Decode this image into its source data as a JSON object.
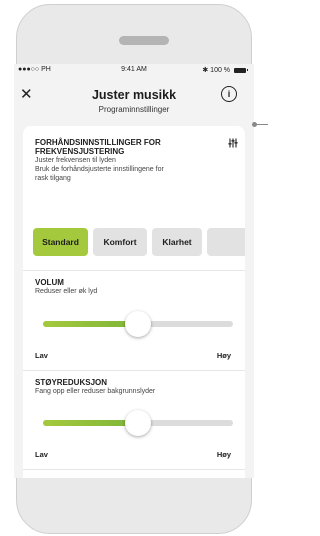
{
  "statusbar": {
    "carrier": "●●●○○ PH",
    "time": "9:41 AM",
    "battery": "✱ 100 %"
  },
  "header": {
    "title": "Juster musikk",
    "subtitle": "Programinnstillinger",
    "close_glyph": "✕",
    "info_glyph": "i"
  },
  "presets_section": {
    "title_line1": "FORHÅNDSINNSTILLINGER FOR",
    "title_line2": "FREKVENSJUSTERING",
    "desc_line1": "Juster frekvensen til lyden",
    "desc_line2": "Bruk de forhåndsjusterte innstillingene for",
    "desc_line3": "rask tilgang",
    "eq_icon": "equalizer-icon",
    "buttons": [
      {
        "label": "Standard",
        "active": true
      },
      {
        "label": "Komfort",
        "active": false
      },
      {
        "label": "Klarhet",
        "active": false
      },
      {
        "label": "",
        "active": false
      }
    ]
  },
  "volume": {
    "title": "VOLUM",
    "desc": "Reduser eller øk lyd",
    "min_label": "Lav",
    "max_label": "Høy",
    "value_fraction": 0.5
  },
  "noise": {
    "title": "STØYREDUKSJON",
    "desc": "Fang opp eller reduser bakgrunnslyder",
    "min_label": "Lav",
    "max_label": "Høy",
    "value_fraction": 0.5
  },
  "colors": {
    "accent_green": "#a5c93d",
    "button_inactive": "#e2e2e2"
  }
}
